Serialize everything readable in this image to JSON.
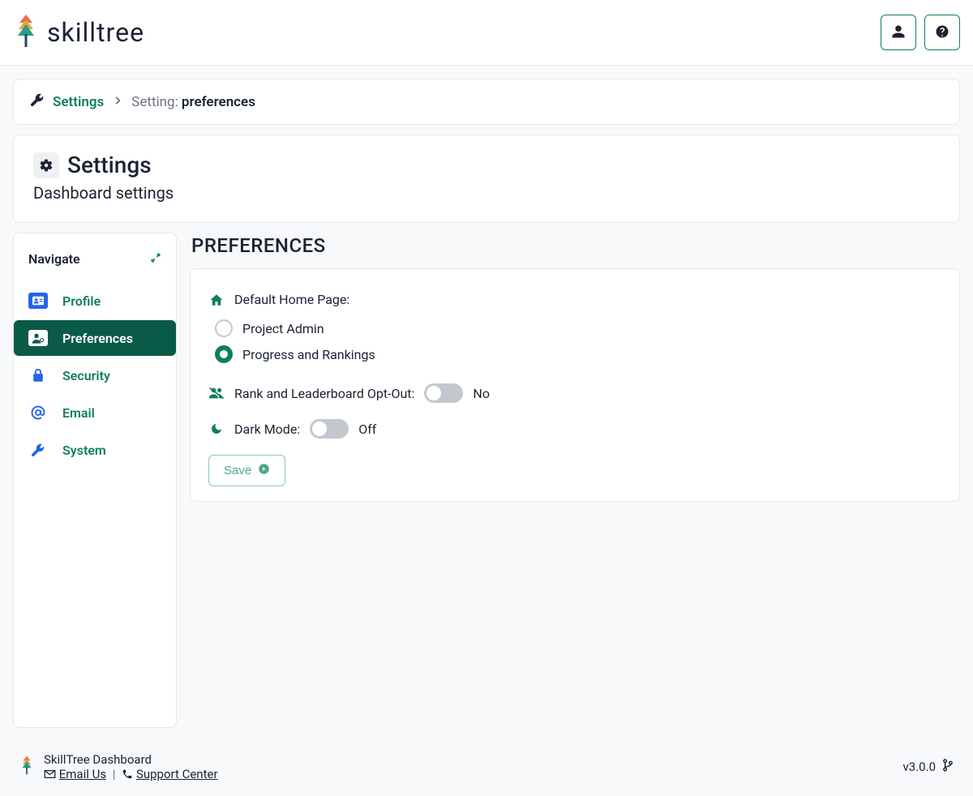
{
  "header": {
    "brand": "skilltree"
  },
  "breadcrumb": {
    "root": "Settings",
    "label": "Setting: ",
    "current": "preferences"
  },
  "page": {
    "title": "Settings",
    "subtitle": "Dashboard settings"
  },
  "sidebar": {
    "title": "Navigate",
    "items": [
      {
        "label": "Profile"
      },
      {
        "label": "Preferences"
      },
      {
        "label": "Security"
      },
      {
        "label": "Email"
      },
      {
        "label": "System"
      }
    ]
  },
  "preferences": {
    "section_title": "PREFERENCES",
    "home_page_label": "Default Home Page:",
    "home_page_options": [
      {
        "label": "Project Admin"
      },
      {
        "label": "Progress and Rankings"
      }
    ],
    "home_page_selected": "Progress and Rankings",
    "opt_out_label": "Rank and Leaderboard Opt-Out:",
    "opt_out_value": "No",
    "dark_mode_label": "Dark Mode:",
    "dark_mode_value": "Off",
    "save_label": "Save"
  },
  "footer": {
    "product": "SkillTree Dashboard",
    "email_us": "Email Us",
    "support": "Support Center",
    "version": "v3.0.0"
  }
}
